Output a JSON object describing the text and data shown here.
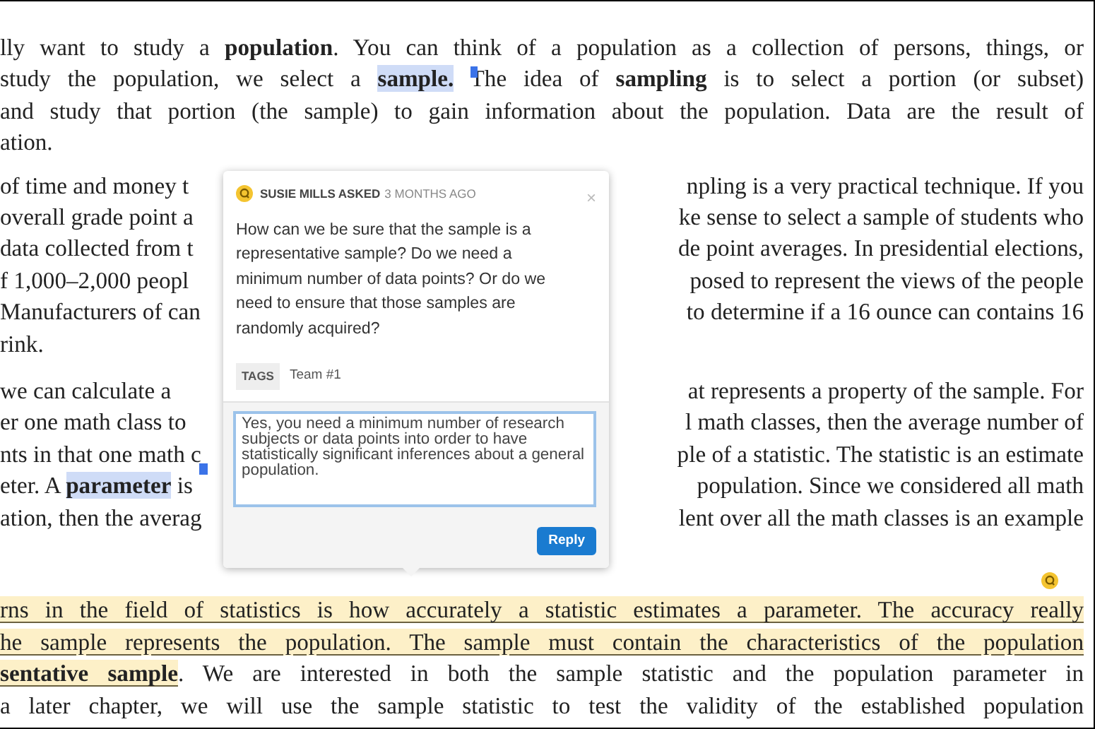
{
  "document": {
    "paragraphs": [
      {
        "lines": [
          {
            "kind": "full",
            "left": [
              {
                "text": "lly want to study a **population**. You can think of a population as a collection of persons, things, or",
                "kind": "plain"
              }
            ]
          },
          {
            "kind": "full",
            "left": [
              {
                "text": "study the population, we select a ",
                "kind": "plain"
              },
              {
                "text": "**sample.**",
                "kind": "selection"
              },
              {
                "text": " The idea of **sampling** is to select a portion (or subset)",
                "kind": "plain"
              }
            ]
          },
          {
            "kind": "full",
            "left": [
              {
                "text": "and study that portion (the sample) to gain information about the population. Data are the result of",
                "kind": "plain"
              }
            ]
          },
          {
            "kind": "end",
            "left": [
              {
                "text": "ation.",
                "kind": "plain"
              }
            ]
          }
        ]
      },
      {
        "lines": [
          {
            "kind": "split",
            "left": [
              {
                "text": "of time and money t",
                "kind": "plain"
              }
            ],
            "right": [
              {
                "text": "npling is a very practical technique. If you",
                "kind": "plain"
              }
            ]
          },
          {
            "kind": "split",
            "left": [
              {
                "text": "overall grade point a",
                "kind": "plain"
              }
            ],
            "right": [
              {
                "text": "ke sense to select a sample of students who",
                "kind": "plain"
              }
            ]
          },
          {
            "kind": "split",
            "left": [
              {
                "text": "data collected from t",
                "kind": "plain"
              }
            ],
            "right": [
              {
                "text": "de point averages. In presidential elections,",
                "kind": "plain"
              }
            ]
          },
          {
            "kind": "split",
            "left": [
              {
                "text": "f 1,000–2,000 peopl",
                "kind": "plain"
              }
            ],
            "right": [
              {
                "text": "posed to represent the views of the people",
                "kind": "plain"
              }
            ]
          },
          {
            "kind": "split",
            "left": [
              {
                "text": "Manufacturers of can",
                "kind": "plain"
              }
            ],
            "right": [
              {
                "text": "to determine if a 16 ounce can contains 16",
                "kind": "plain"
              }
            ]
          },
          {
            "kind": "end",
            "left": [
              {
                "text": "rink.",
                "kind": "plain"
              }
            ]
          }
        ]
      },
      {
        "lines": [
          {
            "kind": "split",
            "left": [
              {
                "text": "we can calculate a",
                "kind": "plain"
              }
            ],
            "right": [
              {
                "text": "at represents a property of the sample. For",
                "kind": "plain"
              }
            ]
          },
          {
            "kind": "split",
            "left": [
              {
                "text": "er one math class to",
                "kind": "plain"
              }
            ],
            "right": [
              {
                "text": "l math classes, then the average number of",
                "kind": "plain"
              }
            ]
          },
          {
            "kind": "split",
            "left": [
              {
                "text": "nts in that one math c",
                "kind": "plain"
              }
            ],
            "right": [
              {
                "text": "ple of a statistic. The statistic is an estimate",
                "kind": "plain"
              }
            ]
          },
          {
            "kind": "split",
            "left": [
              {
                "text": "eter. A ",
                "kind": "plain"
              },
              {
                "text": "**parameter**",
                "kind": "selection"
              },
              {
                "text": " is",
                "kind": "plain"
              }
            ],
            "right": [
              {
                "text": "population. Since we considered all math",
                "kind": "plain"
              }
            ]
          },
          {
            "kind": "split",
            "left": [
              {
                "text": "ation, then the averag",
                "kind": "plain"
              }
            ],
            "right": [
              {
                "text": "lent over all the math classes is an example",
                "kind": "plain"
              }
            ]
          }
        ]
      },
      {
        "lines": [
          {
            "kind": "full",
            "left": [
              {
                "text": "rns in the field of statistics is how accurately a statistic estimates a parameter. The accuracy really",
                "kind": "annotation"
              }
            ]
          },
          {
            "kind": "full",
            "left": [
              {
                "text": "he sample represents the population. The sample must contain the characteristics of the population",
                "kind": "annotation"
              }
            ]
          },
          {
            "kind": "full",
            "left": [
              {
                "text": "**sentative sample**",
                "kind": "annotation"
              },
              {
                "text": ". We are interested in both the sample statistic and the population parameter in",
                "kind": "plain"
              }
            ]
          },
          {
            "kind": "full",
            "left": [
              {
                "text": "a later chapter, we will use the sample statistic to test the validity of the established population",
                "kind": "plain"
              }
            ]
          }
        ]
      }
    ]
  },
  "popover": {
    "author": "SUSIE MILLS ASKED",
    "time": "3 MONTHS AGO",
    "close": "×",
    "question": "How can we be sure that the sample is a representative sample? Do we need a minimum number of data points? Or do we need to ensure that those samples are randomly acquired?",
    "tags_label": "TAGS",
    "tags": [
      "Team #1"
    ],
    "reply_value": "Yes, you need a minimum number of research subjects or data points into order to have statistically significant inferences about a general population.",
    "reply_button": "Reply"
  }
}
